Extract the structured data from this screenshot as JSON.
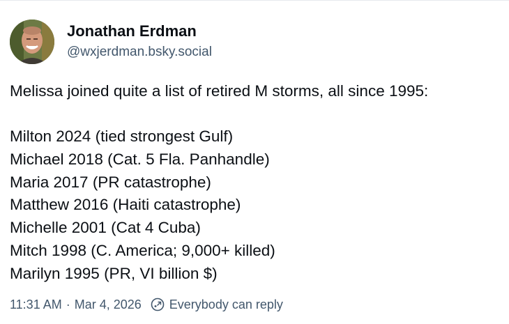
{
  "author": {
    "display_name": "Jonathan Erdman",
    "handle": "@wxjerdman.bsky.social"
  },
  "post": {
    "intro": "Melissa joined quite a list of retired M storms, all since 1995:",
    "storms": [
      "Milton 2024 (tied strongest Gulf)",
      "Michael 2018 (Cat. 5 Fla. Panhandle)",
      "Maria 2017 (PR catastrophe)",
      "Matthew 2016 (Haiti catastrophe)",
      "Michelle 2001 (Cat 4 Cuba)",
      "Mitch 1998 (C. America; 9,000+ killed)",
      "Marilyn 1995 (PR, VI billion $)"
    ]
  },
  "meta": {
    "time": "11:31 AM",
    "separator": "·",
    "date": "Mar 4, 2026",
    "reply_setting": "Everybody can reply",
    "reply_icon": "reply-settings-icon"
  },
  "colors": {
    "text": "#0b0f14",
    "muted": "#42576c",
    "border": "#e6e9ee"
  }
}
